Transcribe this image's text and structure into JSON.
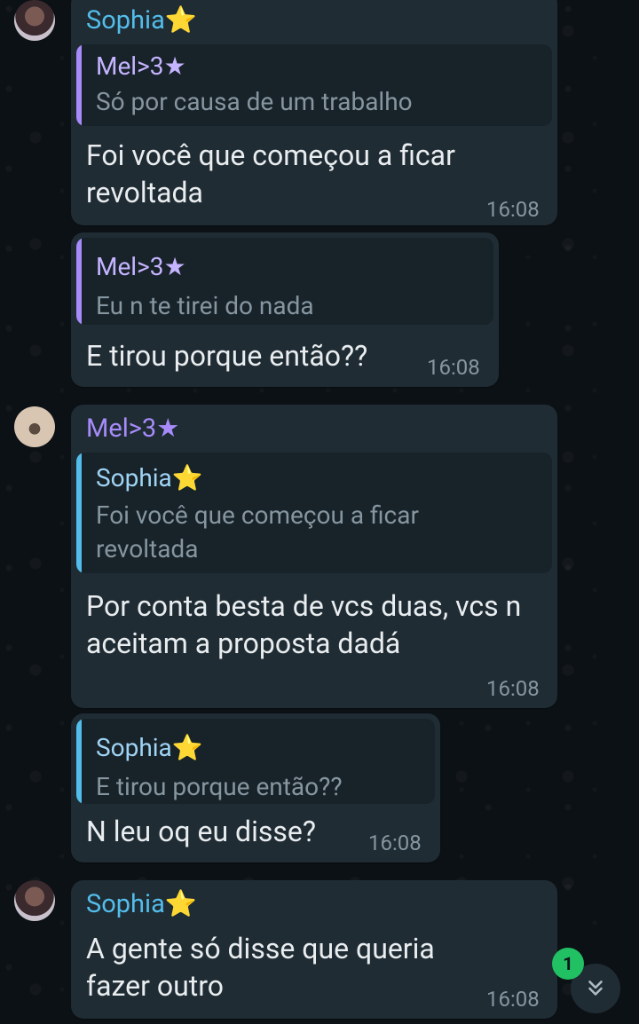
{
  "messages": [
    {
      "sender": "Sophia",
      "sender_suffix": "⭐",
      "quote_author": "Mel>3★",
      "quote_text": "Só por causa de um trabalho",
      "text": "Foi você que começou a ficar revoltada",
      "time": "16:08"
    },
    {
      "quote_author": "Mel>3★",
      "quote_text": "Eu n te tirei do nada",
      "text": "E tirou porque então??",
      "time": "16:08"
    },
    {
      "sender": "Mel>3★",
      "quote_author": "Sophia⭐",
      "quote_text": "Foi você que começou a ficar revoltada",
      "text": "Por conta besta de vcs duas, vcs n aceitam a proposta dadá",
      "time": "16:08"
    },
    {
      "quote_author": "Sophia⭐",
      "quote_text": "E tirou porque então??",
      "text": "N leu oq eu disse?",
      "time": "16:08"
    },
    {
      "sender": "Sophia",
      "sender_suffix": "⭐",
      "text": "A gente só disse que queria fazer outro",
      "time": "16:08"
    }
  ],
  "scroll_button": {
    "unread_count": "1",
    "icon": "double-chevron-down-icon"
  },
  "colors": {
    "bubble": "#1f2c34",
    "quote_bg": "#182229",
    "sophia_name": "#53bdeb",
    "mel_name": "#a78bfa",
    "badge": "#21c063"
  }
}
